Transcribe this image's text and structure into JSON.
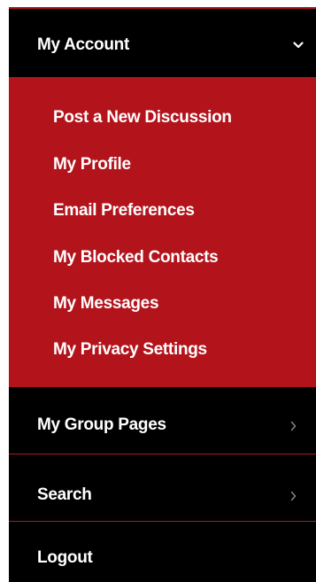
{
  "menu": {
    "header": {
      "label": "My Account",
      "icon": "chevron-down-icon",
      "expanded": true
    },
    "submenu": [
      {
        "label": "Post a New Discussion"
      },
      {
        "label": "My Profile"
      },
      {
        "label": "Email Preferences"
      },
      {
        "label": "My Blocked Contacts"
      },
      {
        "label": "My Messages"
      },
      {
        "label": "My Privacy Settings"
      }
    ],
    "items": [
      {
        "label": "My Group Pages",
        "icon": "chevron-right-icon"
      },
      {
        "label": "Search",
        "icon": "chevron-right-icon"
      },
      {
        "label": "Logout"
      }
    ]
  },
  "colors": {
    "accent": "#b3141c",
    "background": "#000000",
    "text": "#ffffff",
    "chevron_right": "#8a8a8a"
  }
}
